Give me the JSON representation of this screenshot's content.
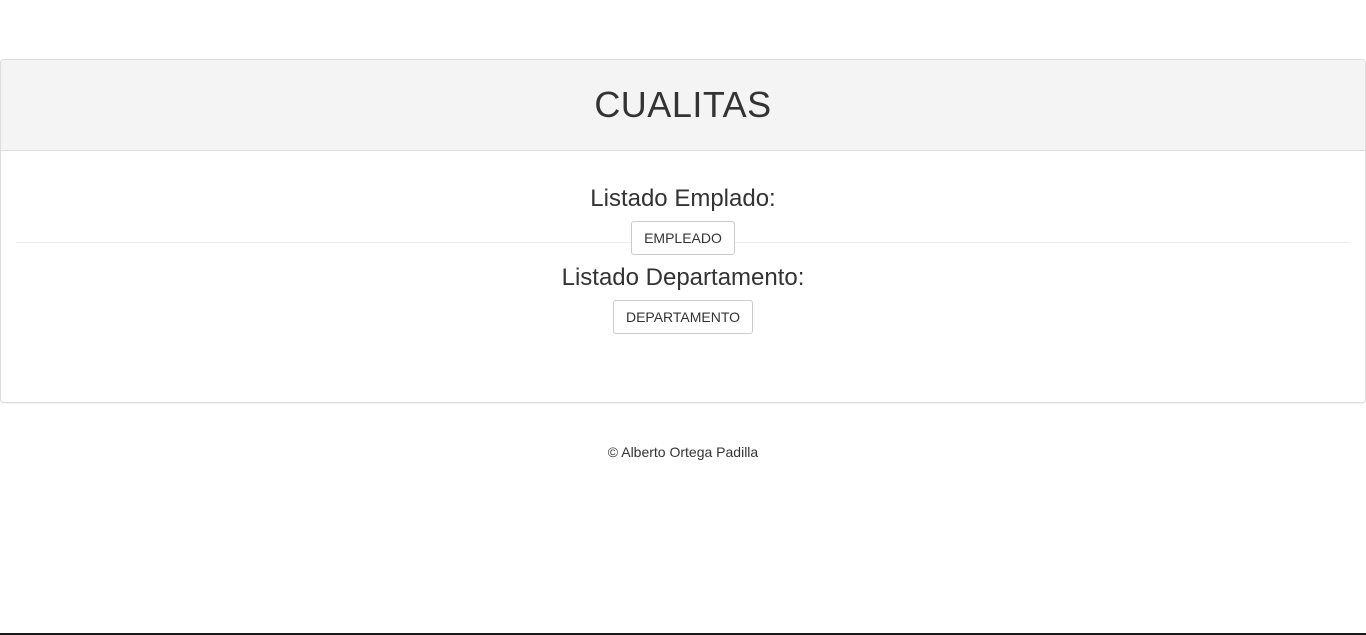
{
  "panel": {
    "title": "CUALITAS"
  },
  "sections": [
    {
      "heading": "Listado Emplado:",
      "button_label": "EMPLEADO"
    },
    {
      "heading": "Listado Departamento:",
      "button_label": "DEPARTAMENTO"
    }
  ],
  "footer": {
    "text": "© Alberto Ortega Padilla"
  }
}
